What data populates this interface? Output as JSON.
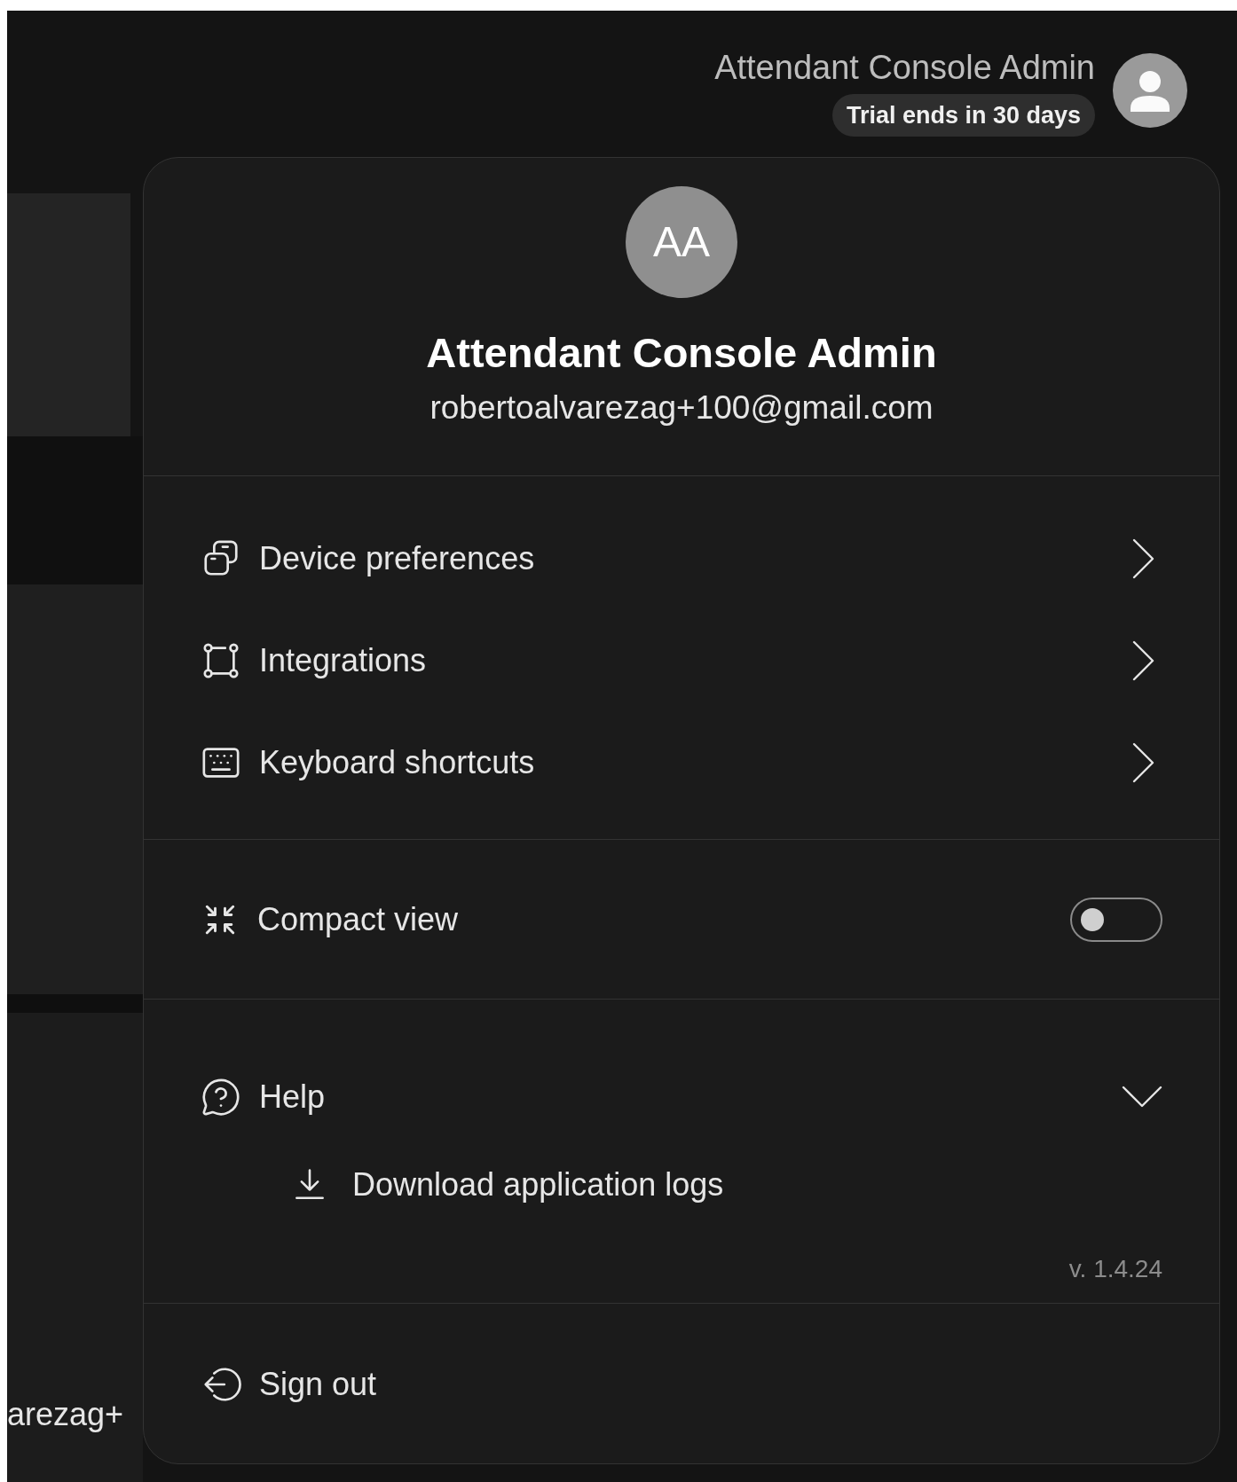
{
  "header": {
    "name": "Attendant Console Admin",
    "trial_badge": "Trial ends in 30 days"
  },
  "profile": {
    "initials": "AA",
    "name": "Attendant Console Admin",
    "email": "robertoalvarezag+100@gmail.com"
  },
  "menu_items": [
    {
      "label": "Device preferences"
    },
    {
      "label": "Integrations"
    },
    {
      "label": "Keyboard shortcuts"
    }
  ],
  "compact_view": {
    "label": "Compact view",
    "on": false
  },
  "help": {
    "label": "Help",
    "expanded": true,
    "items": [
      {
        "label": "Download application logs"
      }
    ],
    "version": "v. 1.4.24"
  },
  "sign_out": {
    "label": "Sign out"
  },
  "background": {
    "text": "arezag+"
  }
}
